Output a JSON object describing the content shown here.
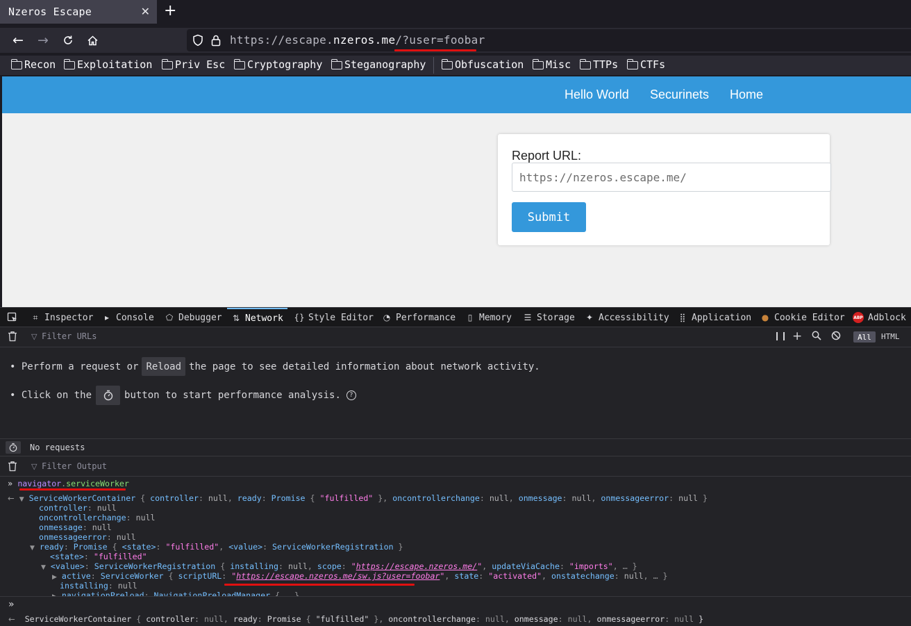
{
  "browser": {
    "tab_title": "Nzeros Escape",
    "url_prefix": "https://escape.",
    "url_host_main": "nzeros.me",
    "url_path": "/?user=foobar"
  },
  "bookmarks": [
    "Recon",
    "Exploitation",
    "Priv Esc",
    "Cryptography",
    "Steganography",
    "Obfuscation",
    "Misc",
    "TTPs",
    "CTFs"
  ],
  "site": {
    "nav": [
      "Hello World",
      "Securinets",
      "Home"
    ],
    "form_label": "Report URL:",
    "input_placeholder": "https://nzeros.escape.me/",
    "submit_label": "Submit"
  },
  "devtools": {
    "tabs": [
      "Inspector",
      "Console",
      "Debugger",
      "Network",
      "Style Editor",
      "Performance",
      "Memory",
      "Storage",
      "Accessibility",
      "Application",
      "Cookie Editor",
      "Adblock"
    ],
    "active_tab": "Network",
    "filter_urls_placeholder": "Filter URLs",
    "type_filters": [
      "All",
      "HTML"
    ],
    "hint1_a": "Perform a request or",
    "hint1_btn": "Reload",
    "hint1_b": "the page to see detailed information about network activity.",
    "hint2_a": "Click on the",
    "hint2_b": "button to start performance analysis.",
    "status": "No requests",
    "filter_output_placeholder": "Filter Output"
  },
  "console": {
    "input_obj": "navigator",
    "input_prop": "serviceWorker",
    "scope_url": "https://escape.nzeros.me/",
    "script_url": "https://escape.nzeros.me/sw.js?user=foobar"
  }
}
